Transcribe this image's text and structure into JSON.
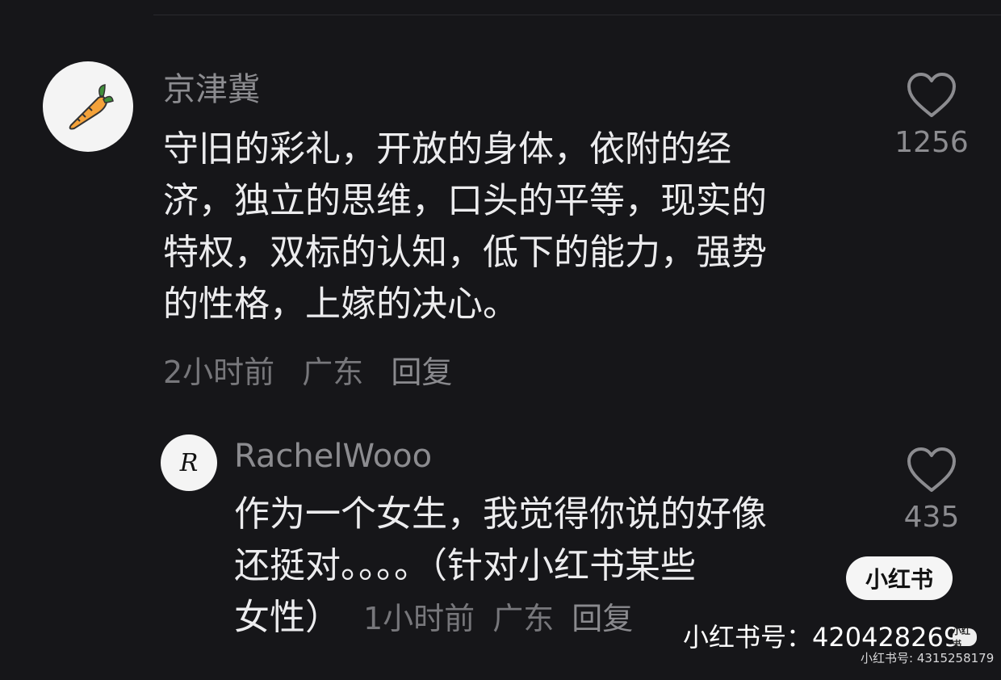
{
  "comment": {
    "username": "京津冀",
    "content_lines": [
      "守旧的彩礼，开放的身体，依附的经",
      "济，独立的思维，口头的平等，现实的",
      "特权，双标的认知，低下的能力，强势",
      "的性格，上嫁的决心。"
    ],
    "time": "2小时前",
    "location": "广东",
    "reply_label": "回复",
    "likes": "1256",
    "avatar_icon": "carrot-icon"
  },
  "reply": {
    "username": "RachelWooo",
    "avatar_text": "R",
    "content_lines": [
      "作为一个女生，我觉得你说的好像",
      "还挺对。。。。（针对小红书某些",
      "女性）"
    ],
    "time": "1小时前",
    "location": "广东",
    "reply_label": "回复",
    "likes": "435"
  },
  "watermark": {
    "badge": "小红书",
    "id_large": "小红书号：420428269",
    "mini_badge": "小红书",
    "id_small": "小红书号: 4315258179"
  },
  "colors": {
    "background": "#161619",
    "text": "#ececee",
    "muted": "#8c8c90"
  }
}
